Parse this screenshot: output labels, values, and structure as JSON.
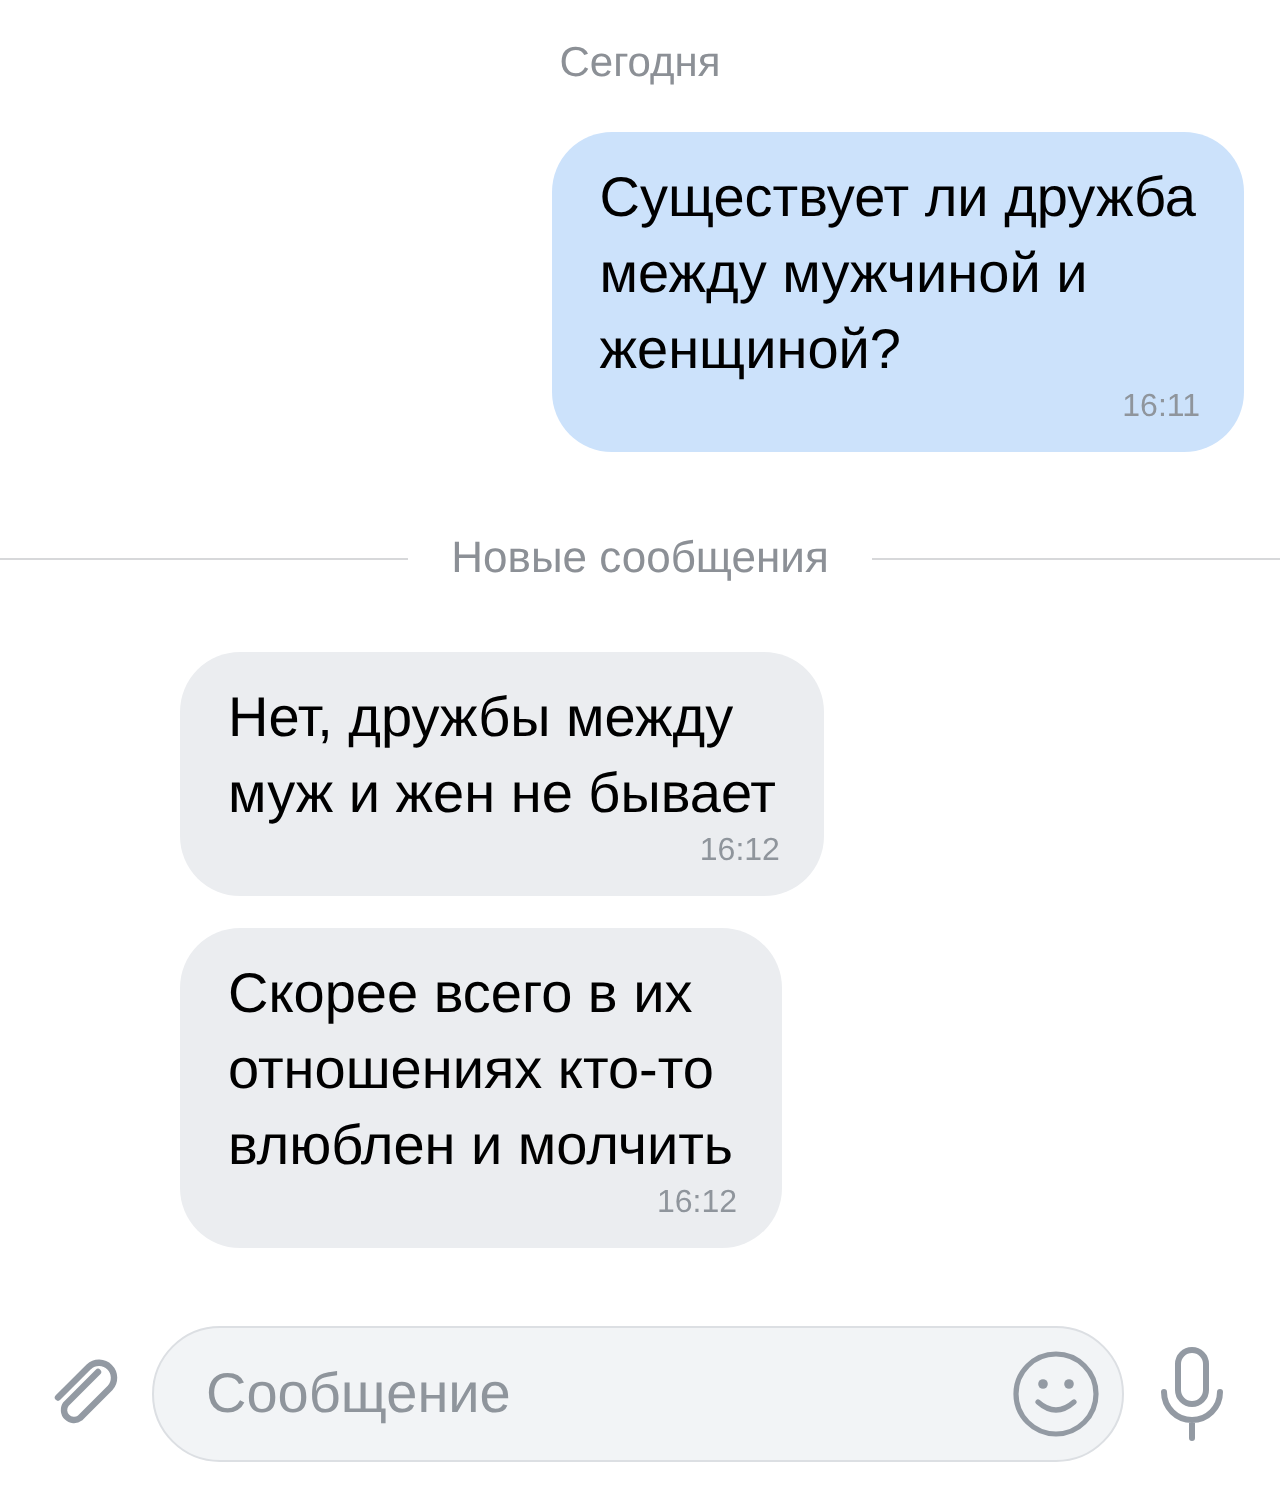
{
  "items": [
    {
      "kind": "date",
      "text": "Сегодня"
    },
    {
      "kind": "message",
      "outgoing": true,
      "lines": [
        "Существует ли дружба",
        "между мужчиной и",
        "женщиной?"
      ],
      "time": "16:11"
    },
    {
      "kind": "divider",
      "text": "Новые сообщения"
    },
    {
      "kind": "message",
      "outgoing": false,
      "lines": [
        "Нет, дружбы между",
        "муж и жен не бывает"
      ],
      "time": "16:12"
    },
    {
      "kind": "message",
      "outgoing": false,
      "lines": [
        "Скорее всего в их",
        "отношениях кто-то",
        "влюблен и молчить"
      ],
      "time": "16:12"
    }
  ],
  "composer": {
    "placeholder": "Сообщение"
  }
}
